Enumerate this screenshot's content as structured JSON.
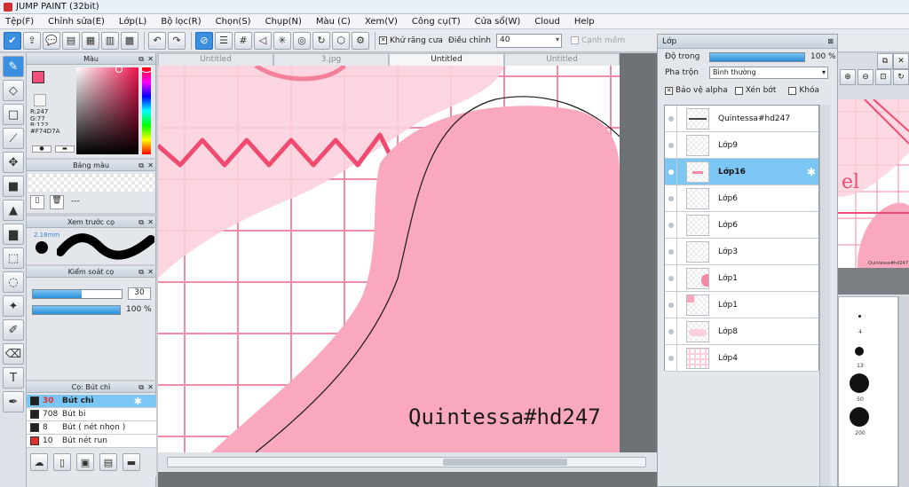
{
  "app": {
    "title": "JUMP PAINT (32bit)"
  },
  "menu": [
    "Tệp(F)",
    "Chỉnh sửa(E)",
    "Lớp(L)",
    "Bộ lọc(R)",
    "Chọn(S)",
    "Chụp(N)",
    "Màu (C)",
    "Xem(V)",
    "Công cụ(T)",
    "Cửa sổ(W)",
    "Cloud",
    "Help"
  ],
  "toolbar": {
    "antialias_label": "Khử răng cưa",
    "adjust_label": "Điều chỉnh",
    "adjust_value": "40",
    "edge_label": "Cạnh mềm"
  },
  "tabs": [
    "Untitled",
    "3.jpg",
    "Untitled",
    "Untitled"
  ],
  "color_panel": {
    "title": "Màu",
    "r": "R:247",
    "g": "G:77",
    "b": "B:122",
    "hex": "#F74D7A",
    "fg_color": "#F74D7A"
  },
  "palette_panel": {
    "title": "Bảng màu",
    "dash": "---"
  },
  "brush_preview": {
    "title": "Xem trước cọ",
    "size": "2.18mm"
  },
  "brush_control": {
    "title": "Kiểm soát cọ",
    "size_value": "30",
    "opacity_value": "100 %",
    "size_fraction": 0.55,
    "opacity_fraction": 1.0
  },
  "pen_panel": {
    "title": "Cọ: Bút chì",
    "pens": [
      {
        "size": "30",
        "name": "Bút chì",
        "color": "#222222",
        "selected": true
      },
      {
        "size": "708",
        "name": "Bút bi",
        "color": "#222222",
        "selected": false
      },
      {
        "size": "8",
        "name": "Bút ( nét nhọn )",
        "color": "#222222",
        "selected": false
      },
      {
        "size": "10",
        "name": "Bút nét run",
        "color": "#e03030",
        "selected": false
      }
    ]
  },
  "canvas": {
    "watermark": "Quintessa#hd247"
  },
  "layer_panel": {
    "title": "Lớp",
    "opacity_label": "Độ trong",
    "opacity_value": "100 %",
    "opacity_fraction": 1.0,
    "blend_label": "Pha trộn",
    "blend_value": "Bình thường",
    "protect_alpha": "Bảo vệ alpha",
    "clip": "Xén bớt",
    "lock": "Khóa",
    "layers": [
      {
        "name": "Quintessa#hd247",
        "selected": false
      },
      {
        "name": "Lớp9",
        "selected": false
      },
      {
        "name": "Lớp16",
        "selected": true
      },
      {
        "name": "Lớp6",
        "selected": false
      },
      {
        "name": "Lớp6",
        "selected": false
      },
      {
        "name": "Lớp3",
        "selected": false
      },
      {
        "name": "Lớp1",
        "selected": false
      },
      {
        "name": "Lớp1",
        "selected": false
      },
      {
        "name": "Lớp8",
        "selected": false
      },
      {
        "name": "Lớp4",
        "selected": false
      }
    ]
  },
  "right_panel": {
    "mini_text": "Quintessa#hd247",
    "brush_sizes": [
      "4",
      "13",
      "50",
      "200"
    ]
  }
}
